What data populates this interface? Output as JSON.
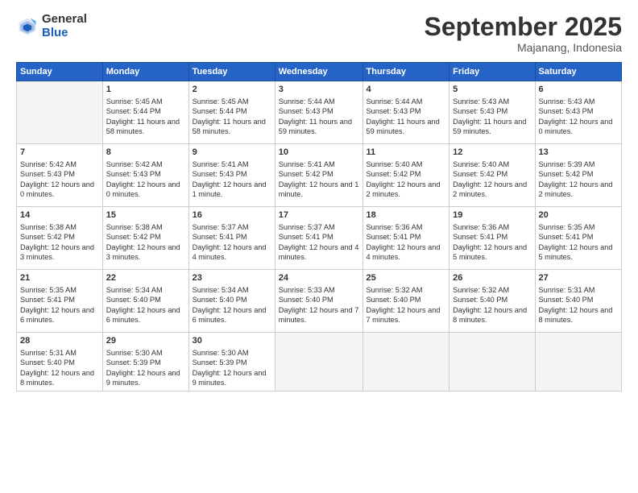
{
  "header": {
    "logo_general": "General",
    "logo_blue": "Blue",
    "month_title": "September 2025",
    "location": "Majanang, Indonesia"
  },
  "days_of_week": [
    "Sunday",
    "Monday",
    "Tuesday",
    "Wednesday",
    "Thursday",
    "Friday",
    "Saturday"
  ],
  "weeks": [
    [
      {
        "day": "",
        "sunrise": "",
        "sunset": "",
        "daylight": ""
      },
      {
        "day": "1",
        "sunrise": "Sunrise: 5:45 AM",
        "sunset": "Sunset: 5:44 PM",
        "daylight": "Daylight: 11 hours and 58 minutes."
      },
      {
        "day": "2",
        "sunrise": "Sunrise: 5:45 AM",
        "sunset": "Sunset: 5:44 PM",
        "daylight": "Daylight: 11 hours and 58 minutes."
      },
      {
        "day": "3",
        "sunrise": "Sunrise: 5:44 AM",
        "sunset": "Sunset: 5:43 PM",
        "daylight": "Daylight: 11 hours and 59 minutes."
      },
      {
        "day": "4",
        "sunrise": "Sunrise: 5:44 AM",
        "sunset": "Sunset: 5:43 PM",
        "daylight": "Daylight: 11 hours and 59 minutes."
      },
      {
        "day": "5",
        "sunrise": "Sunrise: 5:43 AM",
        "sunset": "Sunset: 5:43 PM",
        "daylight": "Daylight: 11 hours and 59 minutes."
      },
      {
        "day": "6",
        "sunrise": "Sunrise: 5:43 AM",
        "sunset": "Sunset: 5:43 PM",
        "daylight": "Daylight: 12 hours and 0 minutes."
      }
    ],
    [
      {
        "day": "7",
        "sunrise": "Sunrise: 5:42 AM",
        "sunset": "Sunset: 5:43 PM",
        "daylight": "Daylight: 12 hours and 0 minutes."
      },
      {
        "day": "8",
        "sunrise": "Sunrise: 5:42 AM",
        "sunset": "Sunset: 5:43 PM",
        "daylight": "Daylight: 12 hours and 0 minutes."
      },
      {
        "day": "9",
        "sunrise": "Sunrise: 5:41 AM",
        "sunset": "Sunset: 5:43 PM",
        "daylight": "Daylight: 12 hours and 1 minute."
      },
      {
        "day": "10",
        "sunrise": "Sunrise: 5:41 AM",
        "sunset": "Sunset: 5:42 PM",
        "daylight": "Daylight: 12 hours and 1 minute."
      },
      {
        "day": "11",
        "sunrise": "Sunrise: 5:40 AM",
        "sunset": "Sunset: 5:42 PM",
        "daylight": "Daylight: 12 hours and 2 minutes."
      },
      {
        "day": "12",
        "sunrise": "Sunrise: 5:40 AM",
        "sunset": "Sunset: 5:42 PM",
        "daylight": "Daylight: 12 hours and 2 minutes."
      },
      {
        "day": "13",
        "sunrise": "Sunrise: 5:39 AM",
        "sunset": "Sunset: 5:42 PM",
        "daylight": "Daylight: 12 hours and 2 minutes."
      }
    ],
    [
      {
        "day": "14",
        "sunrise": "Sunrise: 5:38 AM",
        "sunset": "Sunset: 5:42 PM",
        "daylight": "Daylight: 12 hours and 3 minutes."
      },
      {
        "day": "15",
        "sunrise": "Sunrise: 5:38 AM",
        "sunset": "Sunset: 5:42 PM",
        "daylight": "Daylight: 12 hours and 3 minutes."
      },
      {
        "day": "16",
        "sunrise": "Sunrise: 5:37 AM",
        "sunset": "Sunset: 5:41 PM",
        "daylight": "Daylight: 12 hours and 4 minutes."
      },
      {
        "day": "17",
        "sunrise": "Sunrise: 5:37 AM",
        "sunset": "Sunset: 5:41 PM",
        "daylight": "Daylight: 12 hours and 4 minutes."
      },
      {
        "day": "18",
        "sunrise": "Sunrise: 5:36 AM",
        "sunset": "Sunset: 5:41 PM",
        "daylight": "Daylight: 12 hours and 4 minutes."
      },
      {
        "day": "19",
        "sunrise": "Sunrise: 5:36 AM",
        "sunset": "Sunset: 5:41 PM",
        "daylight": "Daylight: 12 hours and 5 minutes."
      },
      {
        "day": "20",
        "sunrise": "Sunrise: 5:35 AM",
        "sunset": "Sunset: 5:41 PM",
        "daylight": "Daylight: 12 hours and 5 minutes."
      }
    ],
    [
      {
        "day": "21",
        "sunrise": "Sunrise: 5:35 AM",
        "sunset": "Sunset: 5:41 PM",
        "daylight": "Daylight: 12 hours and 6 minutes."
      },
      {
        "day": "22",
        "sunrise": "Sunrise: 5:34 AM",
        "sunset": "Sunset: 5:40 PM",
        "daylight": "Daylight: 12 hours and 6 minutes."
      },
      {
        "day": "23",
        "sunrise": "Sunrise: 5:34 AM",
        "sunset": "Sunset: 5:40 PM",
        "daylight": "Daylight: 12 hours and 6 minutes."
      },
      {
        "day": "24",
        "sunrise": "Sunrise: 5:33 AM",
        "sunset": "Sunset: 5:40 PM",
        "daylight": "Daylight: 12 hours and 7 minutes."
      },
      {
        "day": "25",
        "sunrise": "Sunrise: 5:32 AM",
        "sunset": "Sunset: 5:40 PM",
        "daylight": "Daylight: 12 hours and 7 minutes."
      },
      {
        "day": "26",
        "sunrise": "Sunrise: 5:32 AM",
        "sunset": "Sunset: 5:40 PM",
        "daylight": "Daylight: 12 hours and 8 minutes."
      },
      {
        "day": "27",
        "sunrise": "Sunrise: 5:31 AM",
        "sunset": "Sunset: 5:40 PM",
        "daylight": "Daylight: 12 hours and 8 minutes."
      }
    ],
    [
      {
        "day": "28",
        "sunrise": "Sunrise: 5:31 AM",
        "sunset": "Sunset: 5:40 PM",
        "daylight": "Daylight: 12 hours and 8 minutes."
      },
      {
        "day": "29",
        "sunrise": "Sunrise: 5:30 AM",
        "sunset": "Sunset: 5:39 PM",
        "daylight": "Daylight: 12 hours and 9 minutes."
      },
      {
        "day": "30",
        "sunrise": "Sunrise: 5:30 AM",
        "sunset": "Sunset: 5:39 PM",
        "daylight": "Daylight: 12 hours and 9 minutes."
      },
      {
        "day": "",
        "sunrise": "",
        "sunset": "",
        "daylight": ""
      },
      {
        "day": "",
        "sunrise": "",
        "sunset": "",
        "daylight": ""
      },
      {
        "day": "",
        "sunrise": "",
        "sunset": "",
        "daylight": ""
      },
      {
        "day": "",
        "sunrise": "",
        "sunset": "",
        "daylight": ""
      }
    ]
  ]
}
